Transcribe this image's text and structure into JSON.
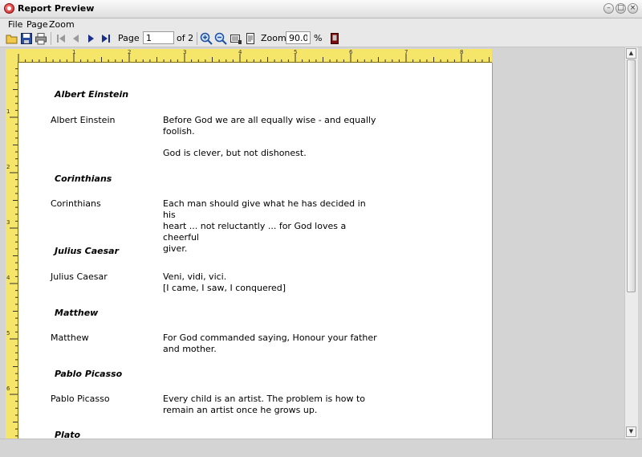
{
  "window": {
    "title": "Report Preview"
  },
  "menu": {
    "items": [
      "File",
      "Page",
      "Zoom"
    ]
  },
  "toolbar": {
    "page_label": "Page",
    "page_value": "1",
    "page_total": "of 2",
    "zoom_label": "Zoom",
    "zoom_value": "90.0",
    "zoom_unit": "%",
    "icons": [
      "open-icon",
      "save-icon",
      "print-icon",
      "first-page-icon",
      "previous-page-icon",
      "next-page-icon",
      "last-page-icon",
      "zoom-in-icon",
      "zoom-out-icon",
      "page-width-icon",
      "whole-page-icon",
      "close-preview-icon"
    ]
  },
  "rulers": {
    "top_numbers": [
      "1",
      "2",
      "3",
      "4",
      "5",
      "6",
      "7",
      "8"
    ],
    "left_numbers": [
      "1",
      "2",
      "3",
      "4",
      "5",
      "6"
    ]
  },
  "report": {
    "entries": [
      {
        "heading": "Albert  Einstein",
        "author": "Albert  Einstein",
        "quotes": [
          "Before God we are all equally wise - and equally\nfoolish.",
          "God is clever, but not dishonest."
        ]
      },
      {
        "heading": "Corinthians",
        "author": "Corinthians",
        "quotes": [
          "Each man should give what he has decided in his\nheart ... not reluctantly ... for God loves a cheerful\ngiver."
        ]
      },
      {
        "heading": "Julius  Caesar",
        "author": "Julius  Caesar",
        "quotes": [
          "Veni,  vidi,  vici.\n[I came, I saw, I conquered]"
        ]
      },
      {
        "heading": "Matthew",
        "author": "Matthew",
        "quotes": [
          "For  God commanded saying, Honour your father\nand mother."
        ]
      },
      {
        "heading": "Pablo  Picasso",
        "author": "Pablo  Picasso",
        "quotes": [
          "Every child is an artist. The problem is how to\nremain an artist once he grows up."
        ]
      },
      {
        "heading": "Plato"
      }
    ]
  }
}
